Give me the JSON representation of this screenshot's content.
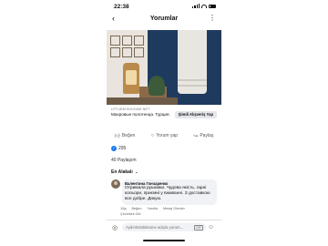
{
  "status_bar": {
    "time": "22:38"
  },
  "header": {
    "title": "Yorumlar"
  },
  "ad": {
    "domain": "LPTURKISHHOME.NET",
    "headline": "Махровые полотенца. Турция.",
    "cta_label": "Şimdi Alışveriş Yap"
  },
  "actions": {
    "like": "Beğen",
    "comment": "Yorum yap",
    "share": "Paylaş"
  },
  "reactions": {
    "count": "295"
  },
  "shares": {
    "label": "40 Paylaşım"
  },
  "sort": {
    "label": "En Alakalı"
  },
  "comment": {
    "author": "Валентина Гончаренко",
    "text": "Отримала рушники. Чудова якість, гарні кольори, приємні у вживанні. З доставкою все добре. Дякую.",
    "time": "10д",
    "like": "Beğen",
    "reply": "Yanıtla",
    "send_message": "Mesaj Gönder",
    "translate": "Çevirisini Gör"
  },
  "composer": {
    "placeholder": "Aydınkötülüksüne adıyla yorum..."
  },
  "colors": {
    "accent": "#1877f2",
    "background": "#ffffff",
    "bubble": "#f0f2f5"
  },
  "icons": [
    "back-arrow-icon",
    "more-icon",
    "like-icon",
    "comment-icon",
    "share-icon",
    "camera-icon",
    "gif-icon",
    "emoji-icon"
  ]
}
